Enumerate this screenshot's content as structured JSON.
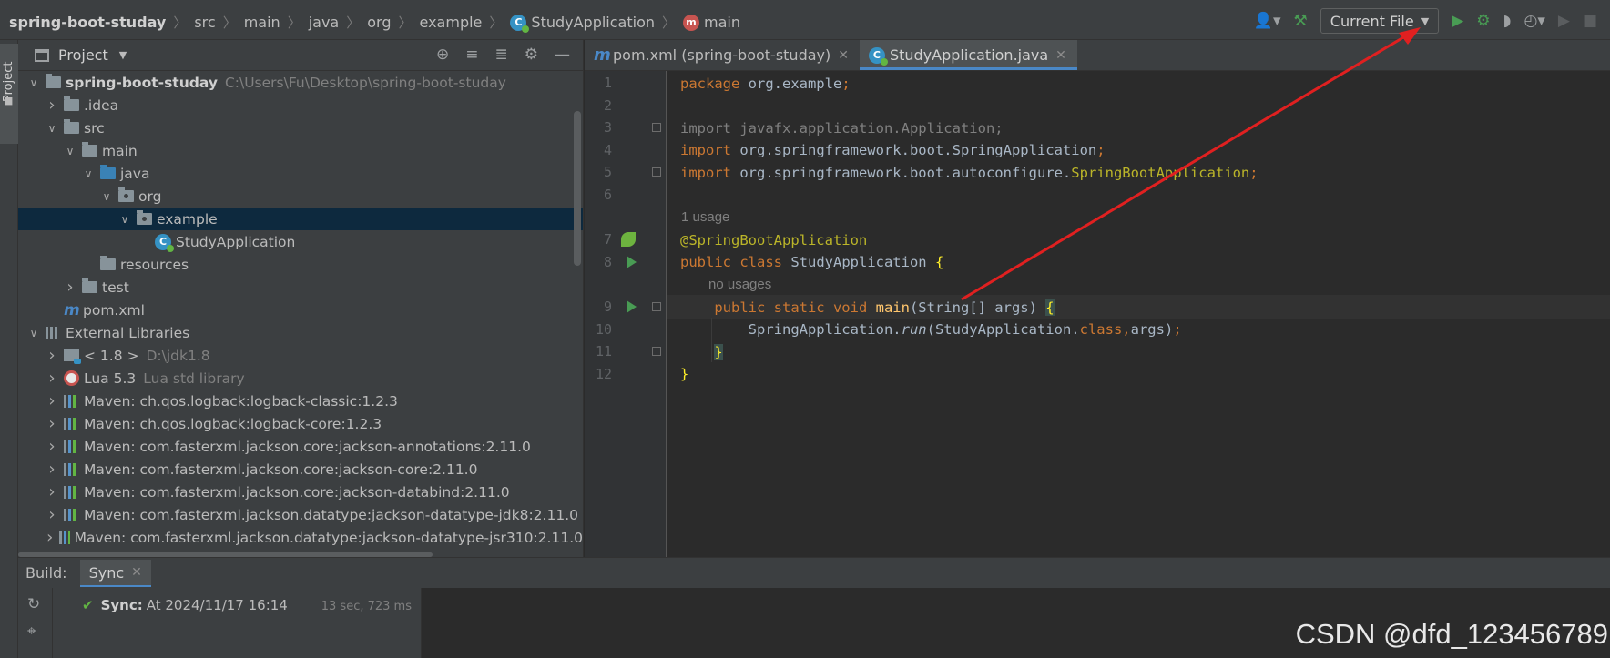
{
  "breadcrumbs": [
    {
      "label": "spring-boot-studay",
      "icon": "none",
      "bold": true
    },
    {
      "label": "src",
      "icon": "none"
    },
    {
      "label": "main",
      "icon": "none"
    },
    {
      "label": "java",
      "icon": "none"
    },
    {
      "label": "org",
      "icon": "none"
    },
    {
      "label": "example",
      "icon": "none"
    },
    {
      "label": "StudyApplication",
      "icon": "class-icon"
    },
    {
      "label": "main",
      "icon": "method-icon"
    }
  ],
  "toolbar": {
    "run_config": "Current File",
    "icons": [
      "user-icon",
      "build-hammer-icon",
      "run-icon",
      "debug-icon",
      "coverage-icon",
      "profile-icon",
      "rerun-icon",
      "stop-icon"
    ]
  },
  "left_stripe": {
    "project_tab": "Project"
  },
  "project_panel": {
    "title": "Project",
    "actions": [
      "locate-icon",
      "expand-all-icon",
      "collapse-all-icon",
      "settings-icon",
      "hide-icon"
    ],
    "tree": [
      {
        "depth": 0,
        "arrow": "down",
        "icon": "module-folder",
        "label": "spring-boot-studay",
        "bold": true,
        "path": "C:\\Users\\Fu\\Desktop\\spring-boot-studay"
      },
      {
        "depth": 1,
        "arrow": "right",
        "icon": "folder",
        "label": ".idea"
      },
      {
        "depth": 1,
        "arrow": "down",
        "icon": "folder",
        "label": "src"
      },
      {
        "depth": 2,
        "arrow": "down",
        "icon": "folder",
        "label": "main"
      },
      {
        "depth": 3,
        "arrow": "down",
        "icon": "source-folder",
        "label": "java"
      },
      {
        "depth": 4,
        "arrow": "down",
        "icon": "package",
        "label": "org"
      },
      {
        "depth": 5,
        "arrow": "down",
        "icon": "package",
        "label": "example",
        "selected": true
      },
      {
        "depth": 6,
        "arrow": "none",
        "icon": "class",
        "label": "StudyApplication"
      },
      {
        "depth": 3,
        "arrow": "none",
        "icon": "resources-folder",
        "label": "resources"
      },
      {
        "depth": 2,
        "arrow": "right",
        "icon": "folder",
        "label": "test"
      },
      {
        "depth": 1,
        "arrow": "none",
        "icon": "maven",
        "label": "pom.xml"
      },
      {
        "depth": 0,
        "arrow": "down",
        "icon": "library",
        "label": "External Libraries"
      },
      {
        "depth": 1,
        "arrow": "right",
        "icon": "jdk",
        "label": "< 1.8 >",
        "path": "D:\\jdk1.8"
      },
      {
        "depth": 1,
        "arrow": "right",
        "icon": "lua",
        "label": "Lua 5.3",
        "path": "Lua std library"
      },
      {
        "depth": 1,
        "arrow": "right",
        "icon": "library-color",
        "label": "Maven: ch.qos.logback:logback-classic:1.2.3"
      },
      {
        "depth": 1,
        "arrow": "right",
        "icon": "library-color",
        "label": "Maven: ch.qos.logback:logback-core:1.2.3"
      },
      {
        "depth": 1,
        "arrow": "right",
        "icon": "library-color",
        "label": "Maven: com.fasterxml.jackson.core:jackson-annotations:2.11.0"
      },
      {
        "depth": 1,
        "arrow": "right",
        "icon": "library-color",
        "label": "Maven: com.fasterxml.jackson.core:jackson-core:2.11.0"
      },
      {
        "depth": 1,
        "arrow": "right",
        "icon": "library-color",
        "label": "Maven: com.fasterxml.jackson.core:jackson-databind:2.11.0"
      },
      {
        "depth": 1,
        "arrow": "right",
        "icon": "library-color",
        "label": "Maven: com.fasterxml.jackson.datatype:jackson-datatype-jdk8:2.11.0"
      },
      {
        "depth": 1,
        "arrow": "right",
        "icon": "library-color",
        "label": "Maven: com.fasterxml.jackson.datatype:jackson-datatype-jsr310:2.11.0"
      }
    ]
  },
  "editor": {
    "tabs": [
      {
        "label": "pom.xml (spring-boot-studay)",
        "icon": "maven",
        "active": false
      },
      {
        "label": "StudyApplication.java",
        "icon": "class",
        "active": true
      }
    ],
    "hints": [
      {
        "text": "1 usage",
        "after_line": 6
      },
      {
        "text": "no usages",
        "after_line": 8
      }
    ],
    "lines": [
      {
        "n": "1",
        "tokens": [
          [
            "kw",
            "package "
          ],
          [
            "pl",
            "org.example"
          ],
          [
            "kw",
            ";"
          ]
        ]
      },
      {
        "n": "2",
        "tokens": []
      },
      {
        "n": "3",
        "tokens": [
          [
            "gray",
            "import javafx.application.Application;"
          ]
        ]
      },
      {
        "n": "4",
        "tokens": [
          [
            "kw",
            "import "
          ],
          [
            "pl",
            "org.springframework.boot.SpringApplication"
          ],
          [
            "kw",
            ";"
          ]
        ]
      },
      {
        "n": "5",
        "tokens": [
          [
            "kw",
            "import "
          ],
          [
            "pl",
            "org.springframework.boot.autoconfigure."
          ],
          [
            "ann",
            "SpringBootApplication"
          ],
          [
            "kw",
            ";"
          ]
        ]
      },
      {
        "n": "6",
        "tokens": []
      },
      {
        "n": "7",
        "tokens": [
          [
            "ann",
            "@SpringBootApplication"
          ]
        ]
      },
      {
        "n": "8",
        "tokens": [
          [
            "kw",
            "public class "
          ],
          [
            "pl",
            "StudyApplication "
          ],
          [
            "brace-hl2",
            "{"
          ]
        ]
      },
      {
        "n": "9",
        "tokens": [
          [
            "pl",
            "    "
          ],
          [
            "kw",
            "public static void "
          ],
          [
            "fn",
            "main"
          ],
          [
            "pl",
            "(String[] args) "
          ],
          [
            "brace-hl",
            "{"
          ]
        ]
      },
      {
        "n": "10",
        "tokens": [
          [
            "pl",
            "        SpringApplication."
          ],
          [
            "it",
            "run"
          ],
          [
            "pl",
            "(StudyApplication."
          ],
          [
            "kw",
            "class"
          ],
          [
            "kw",
            ","
          ],
          [
            "pl",
            "args)"
          ],
          [
            "kw",
            ";"
          ]
        ]
      },
      {
        "n": "11",
        "tokens": [
          [
            "pl",
            "    "
          ],
          [
            "brace-hl",
            "}"
          ]
        ]
      },
      {
        "n": "12",
        "tokens": [
          [
            "brace-hl2",
            "}"
          ]
        ]
      }
    ]
  },
  "build_panel": {
    "label": "Build:",
    "tab": "Sync",
    "sync_title": "Sync:",
    "sync_text": "At 2024/11/17 16:14",
    "sync_duration": "13 sec, 723 ms"
  },
  "watermark": "CSDN @dfd_123456789",
  "colors": {
    "keyword": "#cc7832",
    "plain": "#a9b7c6",
    "annotation": "#bbb529",
    "method": "#ffc66d",
    "arrow": "#e02020",
    "run_green": "#499c54"
  }
}
